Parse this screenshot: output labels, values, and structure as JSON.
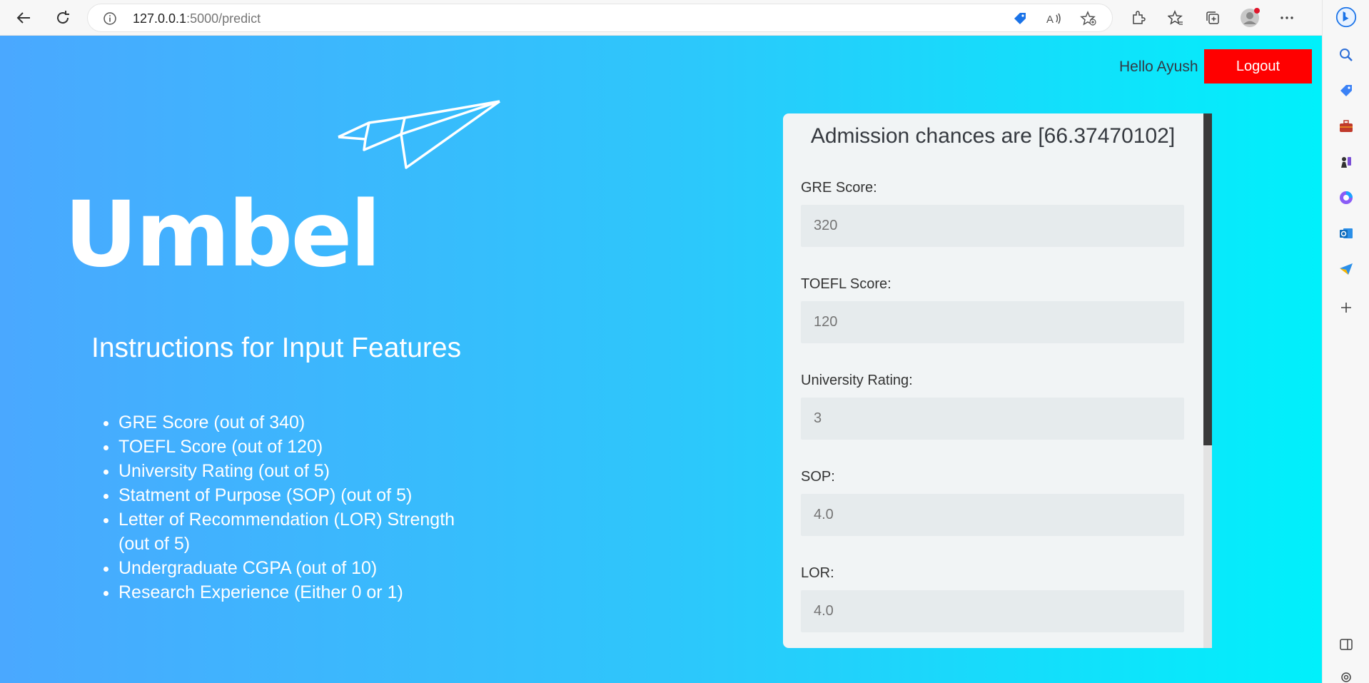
{
  "browser": {
    "url_host": "127.0.0.1",
    "url_path": ":5000/predict"
  },
  "header": {
    "greeting": "Hello Ayush",
    "logout_label": "Logout"
  },
  "logo": {
    "text": "Umbel"
  },
  "instructions": {
    "title": "Instructions for Input Features",
    "items": [
      "GRE Score (out of 340)",
      "TOEFL Score (out of 120)",
      "University Rating (out of 5)",
      "Statment of Purpose (SOP) (out of 5)",
      "Letter of Recommendation (LOR) Strength (out of 5)",
      "Undergraduate CGPA (out of 10)",
      "Research Experience (Either 0 or 1)"
    ]
  },
  "form": {
    "title": "Admission chances are [66.37470102]",
    "fields": [
      {
        "label": "GRE Score:",
        "placeholder": "320"
      },
      {
        "label": "TOEFL Score:",
        "placeholder": "120"
      },
      {
        "label": "University Rating:",
        "placeholder": "3"
      },
      {
        "label": "SOP:",
        "placeholder": "4.0"
      },
      {
        "label": "LOR:",
        "placeholder": "4.0"
      }
    ]
  },
  "colors": {
    "logout_bg": "#ff0000",
    "gradient_start": "#4aa8ff",
    "gradient_end": "#00f0fb"
  }
}
